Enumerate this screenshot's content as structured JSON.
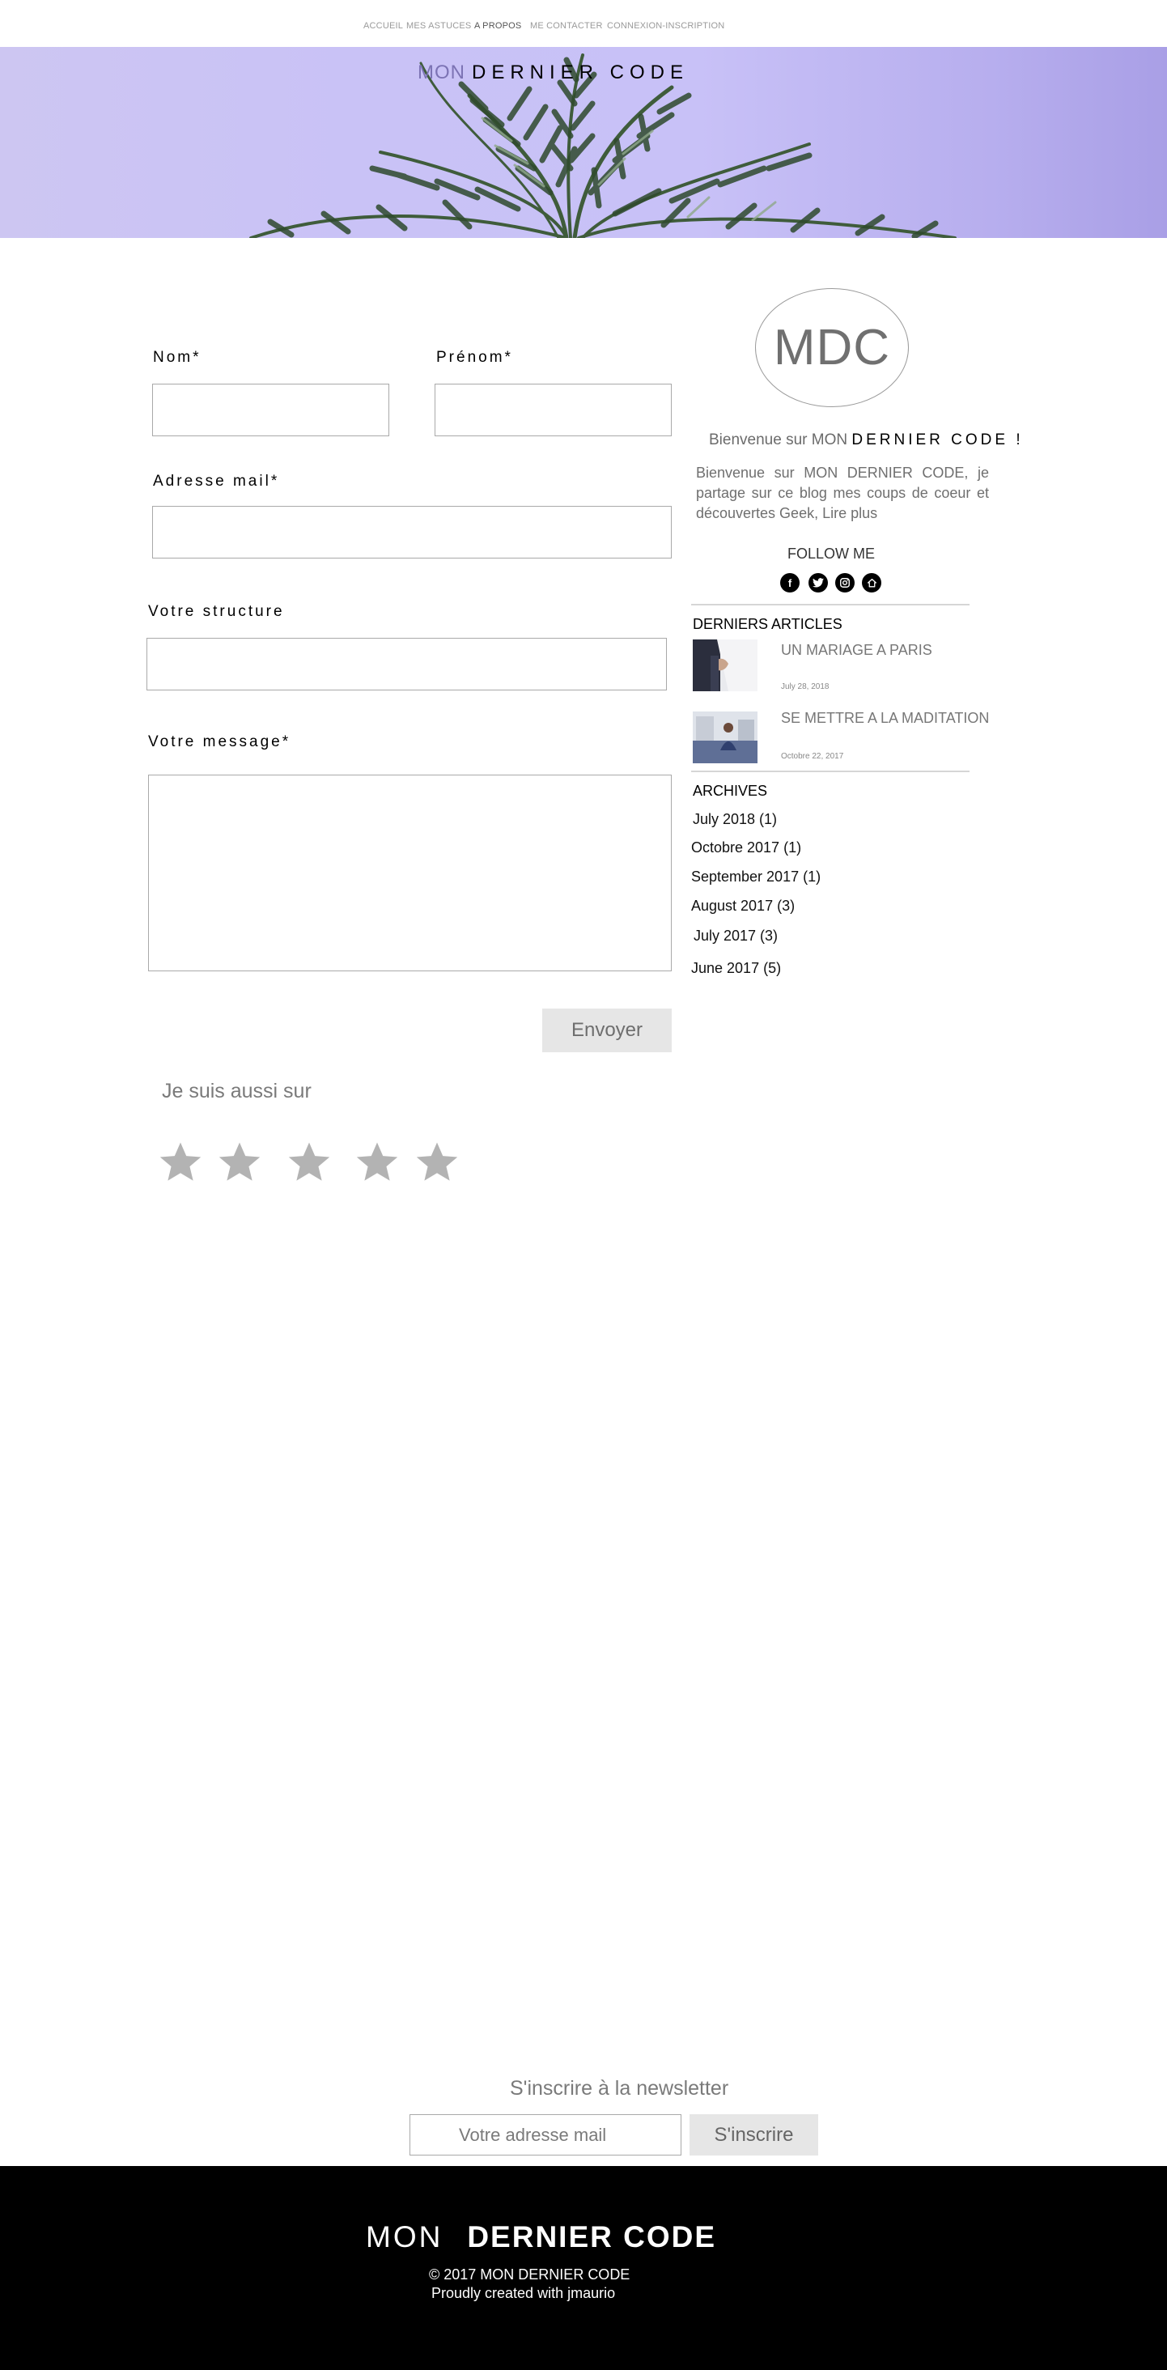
{
  "nav": {
    "items": [
      {
        "label": "ACCUEIL"
      },
      {
        "label": "MES ASTUCES"
      },
      {
        "label": "A PROPOS"
      },
      {
        "label": "ME CONTACTER"
      },
      {
        "label": "CONNEXION-INSCRIPTION"
      }
    ],
    "active": "A PROPOS"
  },
  "header": {
    "brand_mon": "MON",
    "brand_rest": "DERNIER CODE"
  },
  "form": {
    "nom_label": "Nom*",
    "prenom_label": "Prénom*",
    "email_label": "Adresse mail*",
    "structure_label": "Votre structure",
    "message_label": "Votre message*",
    "submit_label": "Envoyer"
  },
  "social_section": {
    "title": "Je suis aussi sur",
    "icons": [
      "star-icon",
      "star-icon",
      "star-icon",
      "star-icon",
      "star-icon"
    ]
  },
  "sidebar": {
    "logo_text": "MDC",
    "welcome_prefix": "Bienvenue sur MON",
    "welcome_brand": "DERNIER CODE !",
    "intro": "Bienvenue sur MON DERNIER CODE, je partage sur ce blog mes coups de coeur et découvertes Geek,  Lire plus",
    "follow_label": "FOLLOW ME",
    "follow_icons": [
      "facebook-icon",
      "twitter-icon",
      "instagram-icon",
      "home-icon"
    ],
    "recent_title": "DERNIERS ARTICLES",
    "articles": [
      {
        "title": "UN MARIAGE A PARIS",
        "date": "July 28, 2018"
      },
      {
        "title": "SE METTRE A LA MADITATION",
        "date": "Octobre 22, 2017"
      }
    ],
    "archives_title": "ARCHIVES",
    "archives": [
      {
        "label": "July 2018 (1)"
      },
      {
        "label": "Octobre 2017 (1)"
      },
      {
        "label": "September 2017 (1)"
      },
      {
        "label": "August 2017 (3)"
      },
      {
        "label": "July 2017 (3)"
      },
      {
        "label": "June 2017 (5)"
      }
    ]
  },
  "newsletter": {
    "title": "S'inscrire à la newsletter",
    "placeholder": "Votre adresse mail",
    "button": "S'inscrire"
  },
  "footer": {
    "brand_mon": "MON",
    "brand_rest": "DERNIER CODE",
    "copyright": "© 2017 MON DERNIER CODE",
    "credit": "Proudly created with jmaurio"
  },
  "colors": {
    "banner_sky": "#c8c1f7",
    "palm": "#3d5a3a",
    "footer_bg": "#000000",
    "button_bg": "#e6e6e6",
    "star": "#b3b3b3"
  }
}
